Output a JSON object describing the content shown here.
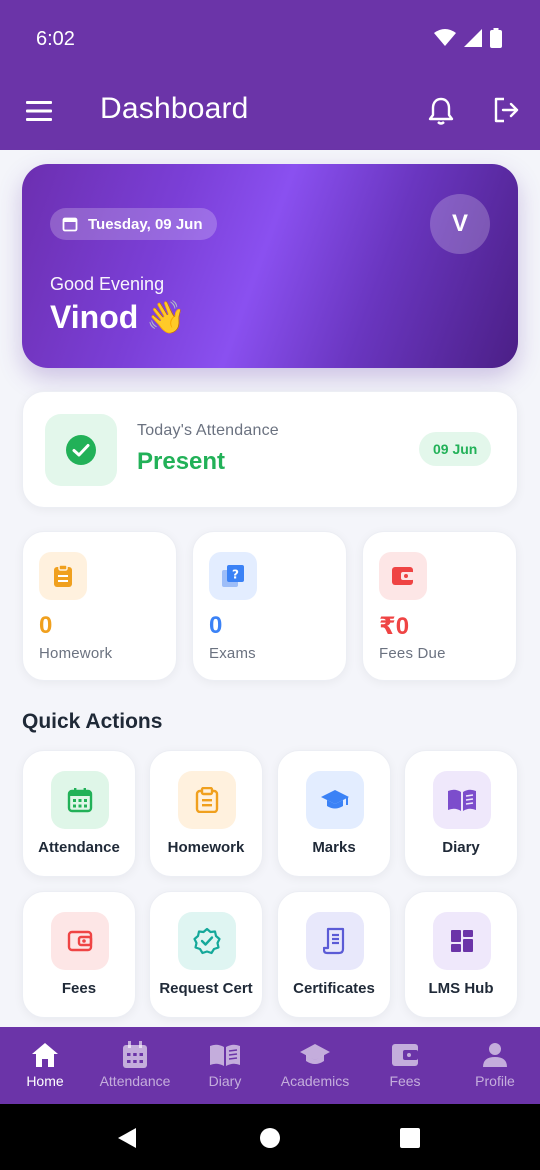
{
  "status_bar": {
    "time": "6:02"
  },
  "app_bar": {
    "title": "Dashboard"
  },
  "hero": {
    "date": "Tuesday, 09 Jun",
    "avatar_initial": "V",
    "greeting": "Good Evening",
    "name": "Vinod",
    "wave_emoji": "👋"
  },
  "attendance": {
    "label": "Today's Attendance",
    "status": "Present",
    "date_badge": "09 Jun",
    "status_color": "#22b158"
  },
  "stats": [
    {
      "value": "0",
      "label": "Homework",
      "icon": "clipboard-icon",
      "color": "#f0a01e",
      "bg": "#fff1de"
    },
    {
      "value": "0",
      "label": "Exams",
      "icon": "quiz-icon",
      "color": "#3b82f6",
      "bg": "#e3edff"
    },
    {
      "value": "₹0",
      "label": "Fees Due",
      "icon": "wallet-icon",
      "color": "#ef4444",
      "bg": "#fde6e6"
    }
  ],
  "quick_actions_title": "Quick Actions",
  "quick_actions": [
    {
      "label": "Attendance",
      "icon": "calendar-icon"
    },
    {
      "label": "Homework",
      "icon": "clipboard-icon"
    },
    {
      "label": "Marks",
      "icon": "graduation-cap-icon"
    },
    {
      "label": "Diary",
      "icon": "book-icon"
    },
    {
      "label": "Fees",
      "icon": "wallet-icon"
    },
    {
      "label": "Request Cert",
      "icon": "verified-badge-icon"
    },
    {
      "label": "Certificates",
      "icon": "document-icon"
    },
    {
      "label": "LMS Hub",
      "icon": "dashboard-grid-icon"
    }
  ],
  "bottom_nav": [
    {
      "label": "Home",
      "icon": "home-icon",
      "active": true
    },
    {
      "label": "Attendance",
      "icon": "calendar-icon"
    },
    {
      "label": "Diary",
      "icon": "book-icon"
    },
    {
      "label": "Academics",
      "icon": "graduation-cap-icon"
    },
    {
      "label": "Fees",
      "icon": "wallet-icon"
    },
    {
      "label": "Profile",
      "icon": "person-icon"
    }
  ],
  "colors": {
    "brand": "#6b34a8",
    "background": "#f4f5fa"
  }
}
